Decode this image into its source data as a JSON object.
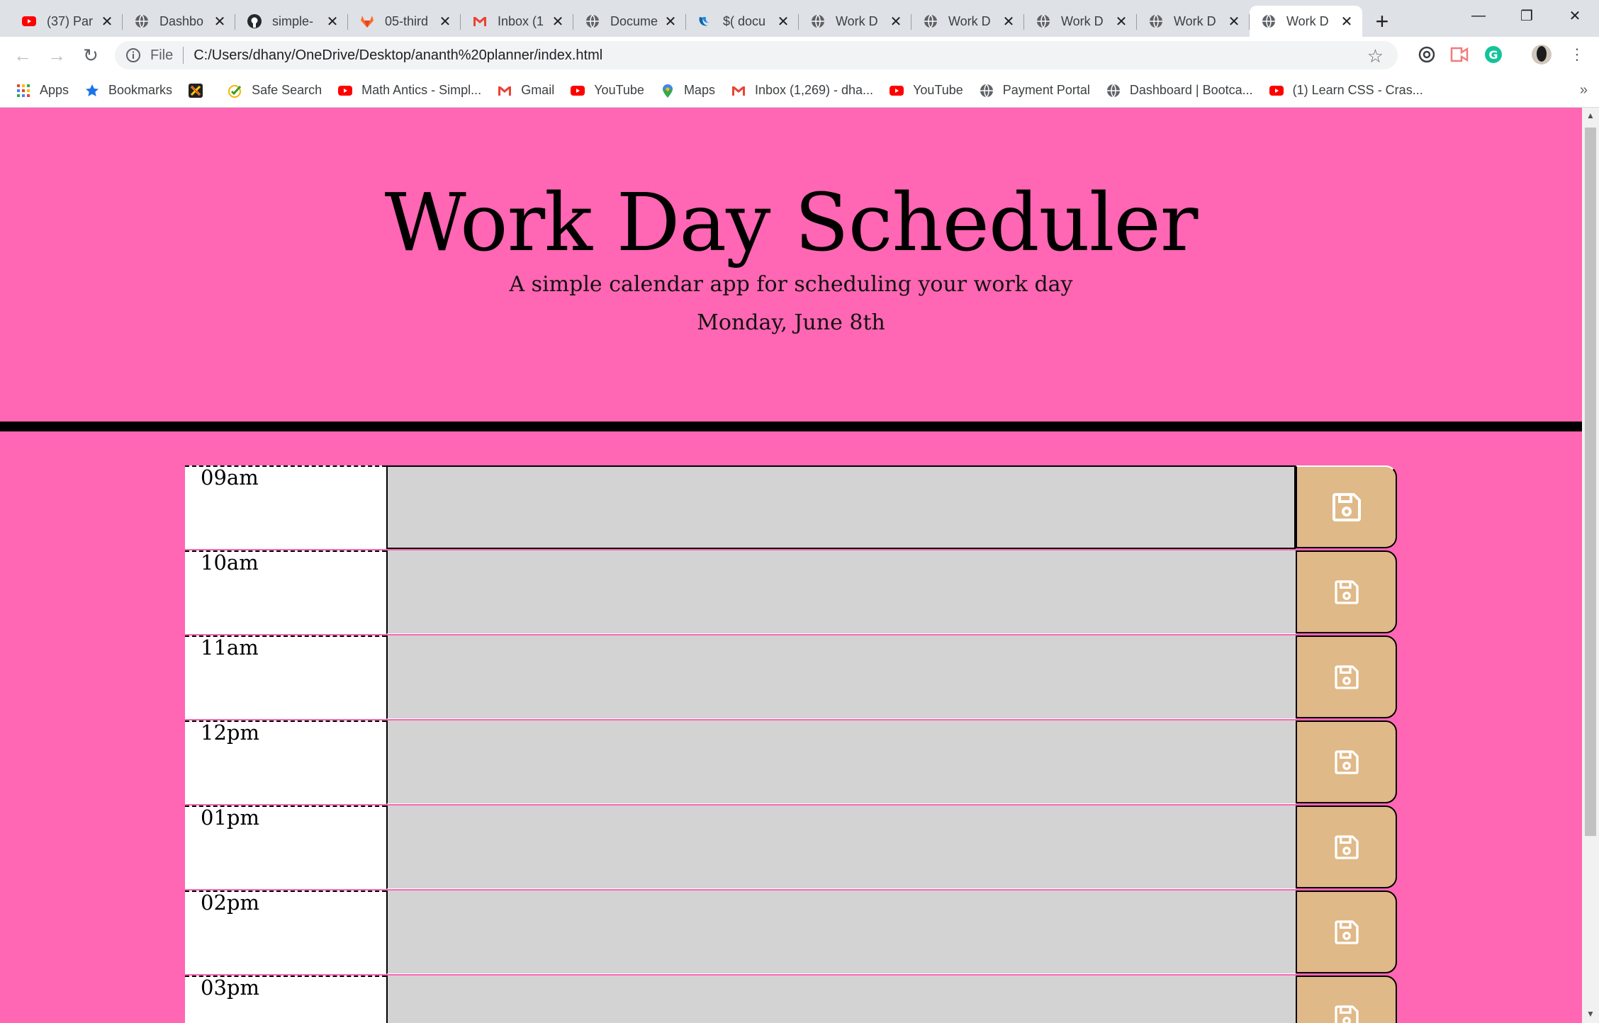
{
  "browser": {
    "tabs": [
      {
        "title": "(37) Par",
        "icon": "youtube-icon"
      },
      {
        "title": "Dashbo",
        "icon": "globe-icon"
      },
      {
        "title": "simple-",
        "icon": "github-icon"
      },
      {
        "title": "05-third",
        "icon": "gitlab-icon"
      },
      {
        "title": "Inbox (1",
        "icon": "gmail-icon"
      },
      {
        "title": "Docume",
        "icon": "globe-icon"
      },
      {
        "title": "$( docu",
        "icon": "jquery-icon"
      },
      {
        "title": "Work D",
        "icon": "globe-icon"
      },
      {
        "title": "Work D",
        "icon": "globe-icon"
      },
      {
        "title": "Work D",
        "icon": "globe-icon"
      },
      {
        "title": "Work D",
        "icon": "globe-icon"
      },
      {
        "title": "Work D",
        "icon": "globe-icon",
        "active": true
      }
    ],
    "address": {
      "scheme_label": "File",
      "url": "C:/Users/dhany/OneDrive/Desktop/ananth%20planner/index.html"
    },
    "bookmarks": [
      {
        "label": "Apps",
        "icon": "apps-grid-icon"
      },
      {
        "label": "Bookmarks",
        "icon": "star-icon"
      },
      {
        "label": "",
        "icon": "app-logo-icon"
      },
      {
        "label": "Safe Search",
        "icon": "safe-search-icon"
      },
      {
        "label": "Math Antics - Simpl...",
        "icon": "youtube-icon"
      },
      {
        "label": "Gmail",
        "icon": "gmail-icon"
      },
      {
        "label": "YouTube",
        "icon": "youtube-icon"
      },
      {
        "label": "Maps",
        "icon": "maps-icon"
      },
      {
        "label": "Inbox (1,269) - dha...",
        "icon": "gmail-icon"
      },
      {
        "label": "YouTube",
        "icon": "youtube-icon"
      },
      {
        "label": "Payment Portal",
        "icon": "globe-icon"
      },
      {
        "label": "Dashboard | Bootca...",
        "icon": "globe-icon"
      },
      {
        "label": "(1) Learn CSS - Cras...",
        "icon": "youtube-icon"
      }
    ],
    "more_label": "»"
  },
  "header": {
    "title": "Work Day Scheduler",
    "lead": "A simple calendar app for scheduling your work day",
    "current_day": "Monday, June 8th"
  },
  "schedule": {
    "rows": [
      {
        "hour": "09am",
        "text": ""
      },
      {
        "hour": "10am",
        "text": ""
      },
      {
        "hour": "11am",
        "text": ""
      },
      {
        "hour": "12pm",
        "text": ""
      },
      {
        "hour": "01pm",
        "text": ""
      },
      {
        "hour": "02pm",
        "text": ""
      },
      {
        "hour": "03pm",
        "text": ""
      }
    ]
  },
  "colors": {
    "page_background": "#ff66b3",
    "textarea_background": "#d3d3d3",
    "save_button": "#e0b988"
  }
}
